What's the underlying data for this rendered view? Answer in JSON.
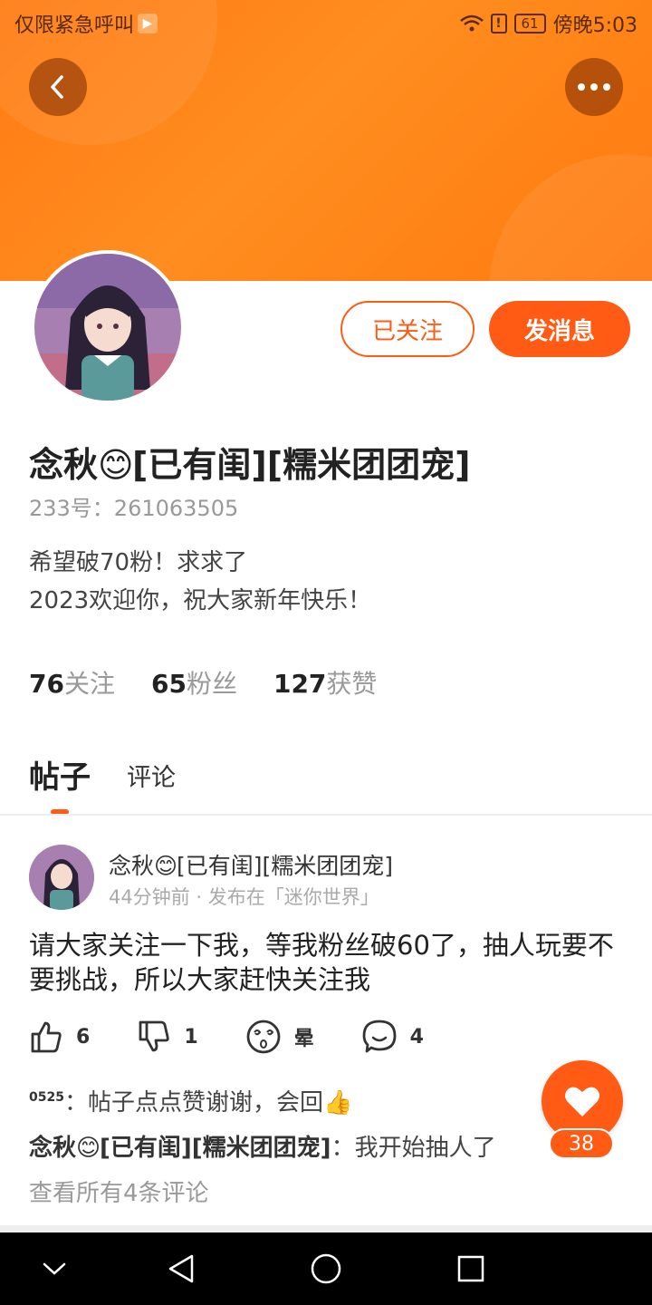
{
  "status_bar": {
    "carrier": "仅限紧急呼叫",
    "battery": "61",
    "time": "傍晚5:03"
  },
  "header": {
    "back_icon": "chevron-left-icon",
    "more_icon": "more-dots-icon"
  },
  "profile": {
    "name_part1": "念秋",
    "name_emoji": "😊",
    "name_part2": "[已有闺][糯米团团宠]",
    "id_text": "233号：261063505",
    "bio_line1": "希望破70粉！求求了",
    "bio_line2": "2023欢迎你，祝大家新年快乐！",
    "follow_label": "已关注",
    "message_label": "发消息"
  },
  "stats": [
    {
      "value": "76",
      "label": "关注"
    },
    {
      "value": "65",
      "label": "粉丝"
    },
    {
      "value": "127",
      "label": "获赞"
    }
  ],
  "tabs": [
    {
      "label": "帖子"
    },
    {
      "label": "评论"
    }
  ],
  "post": {
    "author_part1": "念秋",
    "author_emoji": "😊",
    "author_part2": "[已有闺][糯米团团宠]",
    "meta": "44分钟前 · 发布在「迷你世界」",
    "text": "请大家关注一下我，等我粉丝破60了，抽人玩要不要挑战，所以大家赶快关注我",
    "likes": "6",
    "dislikes": "1",
    "dizzy_label": "晕",
    "comments": "4"
  },
  "comments": [
    {
      "user": "0525",
      "text": "：帖子点点赞谢谢，会回",
      "emoji": "👍"
    },
    {
      "user_part1": "念秋",
      "user_emoji": "😊",
      "user_part2": "[已有闺][糯米团团宠]",
      "text": "：我开始抽人了"
    }
  ],
  "view_all": "查看所有4条评论",
  "like_fab": {
    "count": "38"
  },
  "colors": {
    "accent": "#ff5b14",
    "banner": "#ff8a1c"
  }
}
